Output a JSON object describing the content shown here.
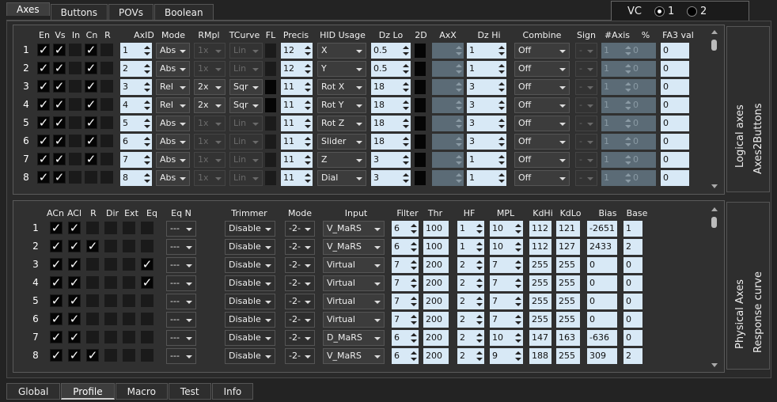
{
  "top_tabs": [
    "Axes",
    "Buttons",
    "POVs",
    "Boolean"
  ],
  "vc": {
    "label": "VC",
    "option1": "1",
    "option2": "2"
  },
  "logical": {
    "side_title1": "Logical axes",
    "side_title2": "Axes2Buttons",
    "headers": {
      "en": "En",
      "vs": "Vs",
      "in": "In",
      "cn": "Cn",
      "r": "R",
      "axid": "AxID",
      "mode": "Mode",
      "rmpl": "RMpl",
      "tcurve": "TCurve",
      "fl": "FL",
      "precis": "Precis",
      "hid": "HID Usage",
      "dzlo": "Dz Lo",
      "d2": "2D",
      "axx": "AxX",
      "dzhi": "Dz Hi",
      "combine": "Combine",
      "sign": "Sign",
      "naxis": "#Axis",
      "pct": "%",
      "fa3": "FA3 val"
    },
    "rows": [
      {
        "n": "1",
        "en": "✓",
        "vs": "✓",
        "in": "",
        "cn": "✓",
        "r": "",
        "axid": "1",
        "mode": "Abs",
        "rmpl": "1x",
        "tcurve": "Lin",
        "precis": "12",
        "hid": "X",
        "dzlo": "0.5",
        "dzhi": "1",
        "combine": "Off",
        "sign": "-",
        "naxis": "1",
        "pct": "0",
        "fa3": "0"
      },
      {
        "n": "2",
        "en": "✓",
        "vs": "✓",
        "in": "",
        "cn": "✓",
        "r": "",
        "axid": "2",
        "mode": "Abs",
        "rmpl": "1x",
        "tcurve": "Lin",
        "precis": "12",
        "hid": "Y",
        "dzlo": "0.5",
        "dzhi": "1",
        "combine": "Off",
        "sign": "-",
        "naxis": "1",
        "pct": "0",
        "fa3": "0"
      },
      {
        "n": "3",
        "en": "✓",
        "vs": "✓",
        "in": "",
        "cn": "✓",
        "r": "",
        "axid": "3",
        "mode": "Rel",
        "rmpl": "2x",
        "tcurve": "Sqr",
        "precis": "11",
        "hid": "Rot X",
        "dzlo": "18",
        "dzhi": "3",
        "combine": "Off",
        "sign": "-",
        "naxis": "1",
        "pct": "0",
        "fa3": "0"
      },
      {
        "n": "4",
        "en": "✓",
        "vs": "✓",
        "in": "",
        "cn": "✓",
        "r": "",
        "axid": "4",
        "mode": "Rel",
        "rmpl": "2x",
        "tcurve": "Sqr",
        "precis": "11",
        "hid": "Rot Y",
        "dzlo": "18",
        "dzhi": "3",
        "combine": "Off",
        "sign": "-",
        "naxis": "1",
        "pct": "0",
        "fa3": "0"
      },
      {
        "n": "5",
        "en": "✓",
        "vs": "✓",
        "in": "",
        "cn": "✓",
        "r": "",
        "axid": "5",
        "mode": "Abs",
        "rmpl": "1x",
        "tcurve": "Lin",
        "precis": "11",
        "hid": "Rot Z",
        "dzlo": "18",
        "dzhi": "3",
        "combine": "Off",
        "sign": "-",
        "naxis": "1",
        "pct": "0",
        "fa3": "0"
      },
      {
        "n": "6",
        "en": "✓",
        "vs": "✓",
        "in": "",
        "cn": "✓",
        "r": "",
        "axid": "6",
        "mode": "Abs",
        "rmpl": "1x",
        "tcurve": "Lin",
        "precis": "11",
        "hid": "Slider",
        "dzlo": "18",
        "dzhi": "3",
        "combine": "Off",
        "sign": "-",
        "naxis": "1",
        "pct": "0",
        "fa3": "0"
      },
      {
        "n": "7",
        "en": "✓",
        "vs": "✓",
        "in": "",
        "cn": "✓",
        "r": "",
        "axid": "7",
        "mode": "Abs",
        "rmpl": "1x",
        "tcurve": "Lin",
        "precis": "11",
        "hid": "Z",
        "dzlo": "3",
        "dzhi": "1",
        "combine": "Off",
        "sign": "-",
        "naxis": "1",
        "pct": "0",
        "fa3": "0"
      },
      {
        "n": "8",
        "en": "✓",
        "vs": "✓",
        "in": "",
        "cn": "",
        "r": "",
        "axid": "8",
        "mode": "Abs",
        "rmpl": "1x",
        "tcurve": "Lin",
        "precis": "11",
        "hid": "Dial",
        "dzlo": "3",
        "dzhi": "1",
        "combine": "Off",
        "sign": "-",
        "naxis": "1",
        "pct": "0",
        "fa3": "0"
      }
    ]
  },
  "physical": {
    "side_title1": "Physical Axes",
    "side_title2": "Response curve",
    "headers": {
      "acn": "ACn",
      "acl": "ACl",
      "r": "R",
      "dir": "Dir",
      "ext": "Ext",
      "eq": "Eq",
      "eqn": "Eq N",
      "trimmer": "Trimmer",
      "mode": "Mode",
      "input": "Input",
      "filter": "Filter",
      "thr": "Thr",
      "hf": "HF",
      "mpl": "MPL",
      "kdhi": "KdHi",
      "kdlo": "KdLo",
      "bias": "Bias",
      "base": "Base"
    },
    "rows": [
      {
        "n": "1",
        "acn": "✓",
        "acl": "✓",
        "r": "",
        "dir": "",
        "ext": "",
        "eq": "",
        "eqn": "---",
        "trimmer": "Disable",
        "mode": "-2-",
        "input": "V_MaRS",
        "filter": "6",
        "thr": "100",
        "hf": "1",
        "mpl": "10",
        "kdhi": "112",
        "kdlo": "121",
        "bias": "-2651",
        "base": "1"
      },
      {
        "n": "2",
        "acn": "✓",
        "acl": "✓",
        "r": "✓",
        "dir": "",
        "ext": "",
        "eq": "",
        "eqn": "---",
        "trimmer": "Disable",
        "mode": "-2-",
        "input": "V_MaRS",
        "filter": "6",
        "thr": "100",
        "hf": "1",
        "mpl": "10",
        "kdhi": "112",
        "kdlo": "127",
        "bias": "2433",
        "base": "2"
      },
      {
        "n": "3",
        "acn": "✓",
        "acl": "✓",
        "r": "",
        "dir": "",
        "ext": "",
        "eq": "✓",
        "eqn": "---",
        "trimmer": "Disable",
        "mode": "-2-",
        "input": "Virtual",
        "filter": "7",
        "thr": "200",
        "hf": "2",
        "mpl": "7",
        "kdhi": "255",
        "kdlo": "255",
        "bias": "0",
        "base": "0"
      },
      {
        "n": "4",
        "acn": "✓",
        "acl": "✓",
        "r": "",
        "dir": "",
        "ext": "",
        "eq": "✓",
        "eqn": "---",
        "trimmer": "Disable",
        "mode": "-2-",
        "input": "Virtual",
        "filter": "7",
        "thr": "200",
        "hf": "2",
        "mpl": "7",
        "kdhi": "255",
        "kdlo": "255",
        "bias": "0",
        "base": "0"
      },
      {
        "n": "5",
        "acn": "✓",
        "acl": "✓",
        "r": "",
        "dir": "",
        "ext": "",
        "eq": "",
        "eqn": "---",
        "trimmer": "Disable",
        "mode": "-2-",
        "input": "Virtual",
        "filter": "7",
        "thr": "200",
        "hf": "2",
        "mpl": "7",
        "kdhi": "255",
        "kdlo": "255",
        "bias": "0",
        "base": "0"
      },
      {
        "n": "6",
        "acn": "✓",
        "acl": "✓",
        "r": "",
        "dir": "",
        "ext": "",
        "eq": "",
        "eqn": "---",
        "trimmer": "Disable",
        "mode": "-2-",
        "input": "Virtual",
        "filter": "7",
        "thr": "200",
        "hf": "2",
        "mpl": "7",
        "kdhi": "255",
        "kdlo": "255",
        "bias": "0",
        "base": "0"
      },
      {
        "n": "7",
        "acn": "✓",
        "acl": "✓",
        "r": "",
        "dir": "",
        "ext": "",
        "eq": "",
        "eqn": "---",
        "trimmer": "Disable",
        "mode": "-2-",
        "input": "D_MaRS",
        "filter": "6",
        "thr": "200",
        "hf": "2",
        "mpl": "10",
        "kdhi": "147",
        "kdlo": "163",
        "bias": "-636",
        "base": "0"
      },
      {
        "n": "8",
        "acn": "✓",
        "acl": "✓",
        "r": "✓",
        "dir": "",
        "ext": "",
        "eq": "",
        "eqn": "---",
        "trimmer": "Disable",
        "mode": "-2-",
        "input": "V_MaRS",
        "filter": "6",
        "thr": "200",
        "hf": "2",
        "mpl": "9",
        "kdhi": "188",
        "kdlo": "255",
        "bias": "309",
        "base": "2"
      }
    ]
  },
  "bottom_tabs": [
    "Global",
    "Profile",
    "Macro",
    "Test",
    "Info"
  ]
}
